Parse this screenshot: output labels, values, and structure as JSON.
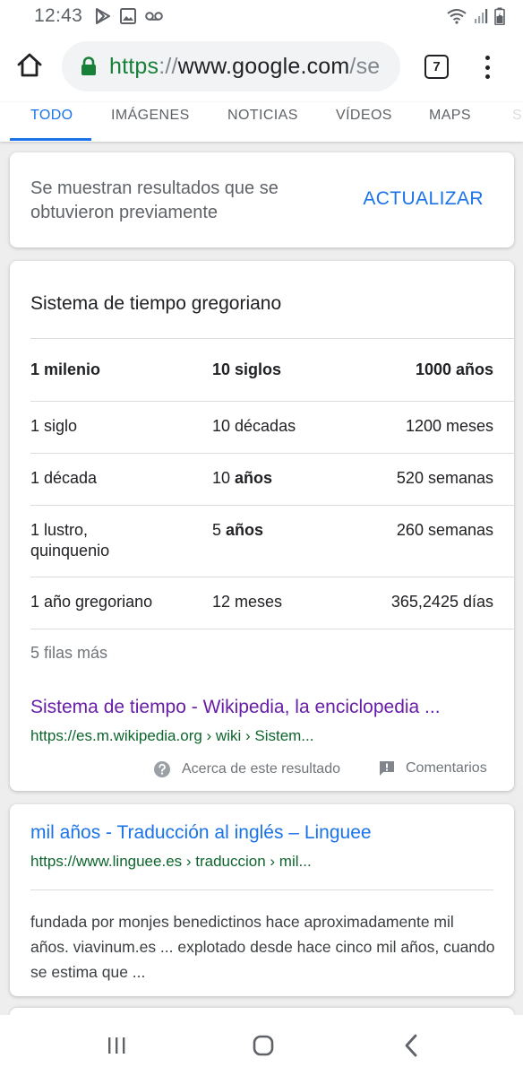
{
  "status_bar": {
    "time": "12:43",
    "icons": [
      "play-store-icon",
      "image-icon",
      "voicemail-icon",
      "wifi-icon",
      "signal-icon",
      "battery-icon"
    ]
  },
  "browser": {
    "url_scheme": "https",
    "url_sep": "://",
    "url_host": "www.google.com",
    "url_rest": "/se",
    "tab_count": "7",
    "icons": [
      "home-icon",
      "lock-icon",
      "more-vert-icon"
    ],
    "colors": {
      "secure": "#188038",
      "accent": "#1a73e8"
    }
  },
  "search_tabs": {
    "items": [
      "TODO",
      "IMÁGENES",
      "NOTICIAS",
      "VÍDEOS",
      "MAPS",
      "S"
    ],
    "active": "TODO"
  },
  "notice": {
    "text": "Se muestran resultados que se obtuvieron previamente",
    "action": "ACTUALIZAR"
  },
  "table": {
    "title": "Sistema de tiempo gregoriano",
    "rows": [
      {
        "c1": "1 milenio",
        "c2a": "10 siglos",
        "c2b": "",
        "c3": "1000 años"
      },
      {
        "c1": "1 siglo",
        "c2a": "10 décadas",
        "c2b": "",
        "c3": "1200 meses"
      },
      {
        "c1": "1 década",
        "c2a": "10 ",
        "c2b": "años",
        "c3": "520 semanas"
      },
      {
        "c1": "1 lustro, quinquenio",
        "c2a": "5 ",
        "c2b": "años",
        "c3": "260 semanas"
      },
      {
        "c1": "1 año gregoriano",
        "c2a": "12 meses",
        "c2b": "",
        "c3": "365,2425 días"
      }
    ],
    "more_rows": "5 filas más"
  },
  "result1": {
    "title": "Sistema de tiempo - Wikipedia, la enciclopedia ...",
    "url": "https://es.m.wikipedia.org › wiki › Sistem...",
    "about": "Acerca de este resultado",
    "feedback": "Comentarios"
  },
  "result2": {
    "title": "mil años - Traducción al inglés – Linguee",
    "url": "https://www.linguee.es › traduccion › mil...",
    "snippet": "fundada por monjes benedictinos hace aproximadamente mil años. viavinum.es ... explotado desde hace cinco mil años, cuando se estima que ..."
  },
  "nav_bar": {
    "icons": [
      "recent-apps-icon",
      "home-circle-icon",
      "back-icon"
    ]
  }
}
